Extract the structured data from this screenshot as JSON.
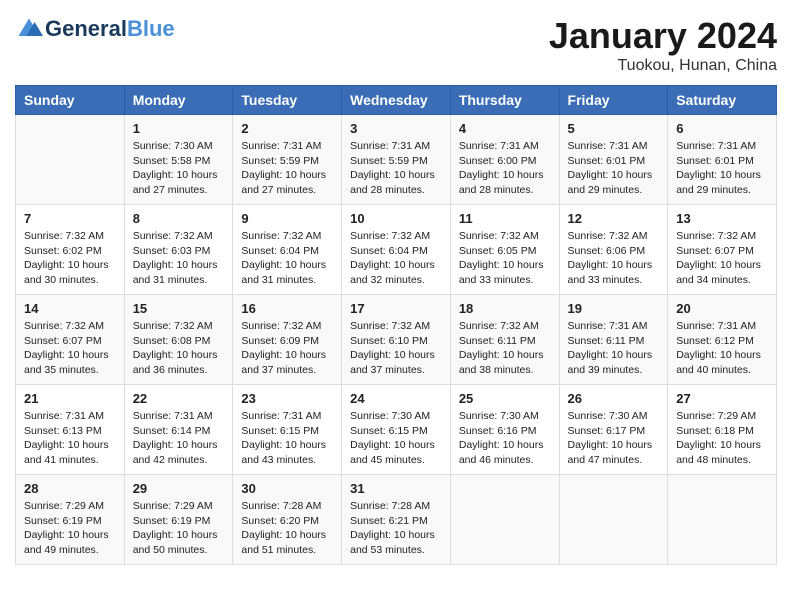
{
  "header": {
    "logo_line1": "General",
    "logo_line2": "Blue",
    "month": "January 2024",
    "location": "Tuokou, Hunan, China"
  },
  "weekdays": [
    "Sunday",
    "Monday",
    "Tuesday",
    "Wednesday",
    "Thursday",
    "Friday",
    "Saturday"
  ],
  "weeks": [
    [
      {
        "day": "",
        "info": ""
      },
      {
        "day": "1",
        "info": "Sunrise: 7:30 AM\nSunset: 5:58 PM\nDaylight: 10 hours\nand 27 minutes."
      },
      {
        "day": "2",
        "info": "Sunrise: 7:31 AM\nSunset: 5:59 PM\nDaylight: 10 hours\nand 27 minutes."
      },
      {
        "day": "3",
        "info": "Sunrise: 7:31 AM\nSunset: 5:59 PM\nDaylight: 10 hours\nand 28 minutes."
      },
      {
        "day": "4",
        "info": "Sunrise: 7:31 AM\nSunset: 6:00 PM\nDaylight: 10 hours\nand 28 minutes."
      },
      {
        "day": "5",
        "info": "Sunrise: 7:31 AM\nSunset: 6:01 PM\nDaylight: 10 hours\nand 29 minutes."
      },
      {
        "day": "6",
        "info": "Sunrise: 7:31 AM\nSunset: 6:01 PM\nDaylight: 10 hours\nand 29 minutes."
      }
    ],
    [
      {
        "day": "7",
        "info": "Sunrise: 7:32 AM\nSunset: 6:02 PM\nDaylight: 10 hours\nand 30 minutes."
      },
      {
        "day": "8",
        "info": "Sunrise: 7:32 AM\nSunset: 6:03 PM\nDaylight: 10 hours\nand 31 minutes."
      },
      {
        "day": "9",
        "info": "Sunrise: 7:32 AM\nSunset: 6:04 PM\nDaylight: 10 hours\nand 31 minutes."
      },
      {
        "day": "10",
        "info": "Sunrise: 7:32 AM\nSunset: 6:04 PM\nDaylight: 10 hours\nand 32 minutes."
      },
      {
        "day": "11",
        "info": "Sunrise: 7:32 AM\nSunset: 6:05 PM\nDaylight: 10 hours\nand 33 minutes."
      },
      {
        "day": "12",
        "info": "Sunrise: 7:32 AM\nSunset: 6:06 PM\nDaylight: 10 hours\nand 33 minutes."
      },
      {
        "day": "13",
        "info": "Sunrise: 7:32 AM\nSunset: 6:07 PM\nDaylight: 10 hours\nand 34 minutes."
      }
    ],
    [
      {
        "day": "14",
        "info": "Sunrise: 7:32 AM\nSunset: 6:07 PM\nDaylight: 10 hours\nand 35 minutes."
      },
      {
        "day": "15",
        "info": "Sunrise: 7:32 AM\nSunset: 6:08 PM\nDaylight: 10 hours\nand 36 minutes."
      },
      {
        "day": "16",
        "info": "Sunrise: 7:32 AM\nSunset: 6:09 PM\nDaylight: 10 hours\nand 37 minutes."
      },
      {
        "day": "17",
        "info": "Sunrise: 7:32 AM\nSunset: 6:10 PM\nDaylight: 10 hours\nand 37 minutes."
      },
      {
        "day": "18",
        "info": "Sunrise: 7:32 AM\nSunset: 6:11 PM\nDaylight: 10 hours\nand 38 minutes."
      },
      {
        "day": "19",
        "info": "Sunrise: 7:31 AM\nSunset: 6:11 PM\nDaylight: 10 hours\nand 39 minutes."
      },
      {
        "day": "20",
        "info": "Sunrise: 7:31 AM\nSunset: 6:12 PM\nDaylight: 10 hours\nand 40 minutes."
      }
    ],
    [
      {
        "day": "21",
        "info": "Sunrise: 7:31 AM\nSunset: 6:13 PM\nDaylight: 10 hours\nand 41 minutes."
      },
      {
        "day": "22",
        "info": "Sunrise: 7:31 AM\nSunset: 6:14 PM\nDaylight: 10 hours\nand 42 minutes."
      },
      {
        "day": "23",
        "info": "Sunrise: 7:31 AM\nSunset: 6:15 PM\nDaylight: 10 hours\nand 43 minutes."
      },
      {
        "day": "24",
        "info": "Sunrise: 7:30 AM\nSunset: 6:15 PM\nDaylight: 10 hours\nand 45 minutes."
      },
      {
        "day": "25",
        "info": "Sunrise: 7:30 AM\nSunset: 6:16 PM\nDaylight: 10 hours\nand 46 minutes."
      },
      {
        "day": "26",
        "info": "Sunrise: 7:30 AM\nSunset: 6:17 PM\nDaylight: 10 hours\nand 47 minutes."
      },
      {
        "day": "27",
        "info": "Sunrise: 7:29 AM\nSunset: 6:18 PM\nDaylight: 10 hours\nand 48 minutes."
      }
    ],
    [
      {
        "day": "28",
        "info": "Sunrise: 7:29 AM\nSunset: 6:19 PM\nDaylight: 10 hours\nand 49 minutes."
      },
      {
        "day": "29",
        "info": "Sunrise: 7:29 AM\nSunset: 6:19 PM\nDaylight: 10 hours\nand 50 minutes."
      },
      {
        "day": "30",
        "info": "Sunrise: 7:28 AM\nSunset: 6:20 PM\nDaylight: 10 hours\nand 51 minutes."
      },
      {
        "day": "31",
        "info": "Sunrise: 7:28 AM\nSunset: 6:21 PM\nDaylight: 10 hours\nand 53 minutes."
      },
      {
        "day": "",
        "info": ""
      },
      {
        "day": "",
        "info": ""
      },
      {
        "day": "",
        "info": ""
      }
    ]
  ]
}
